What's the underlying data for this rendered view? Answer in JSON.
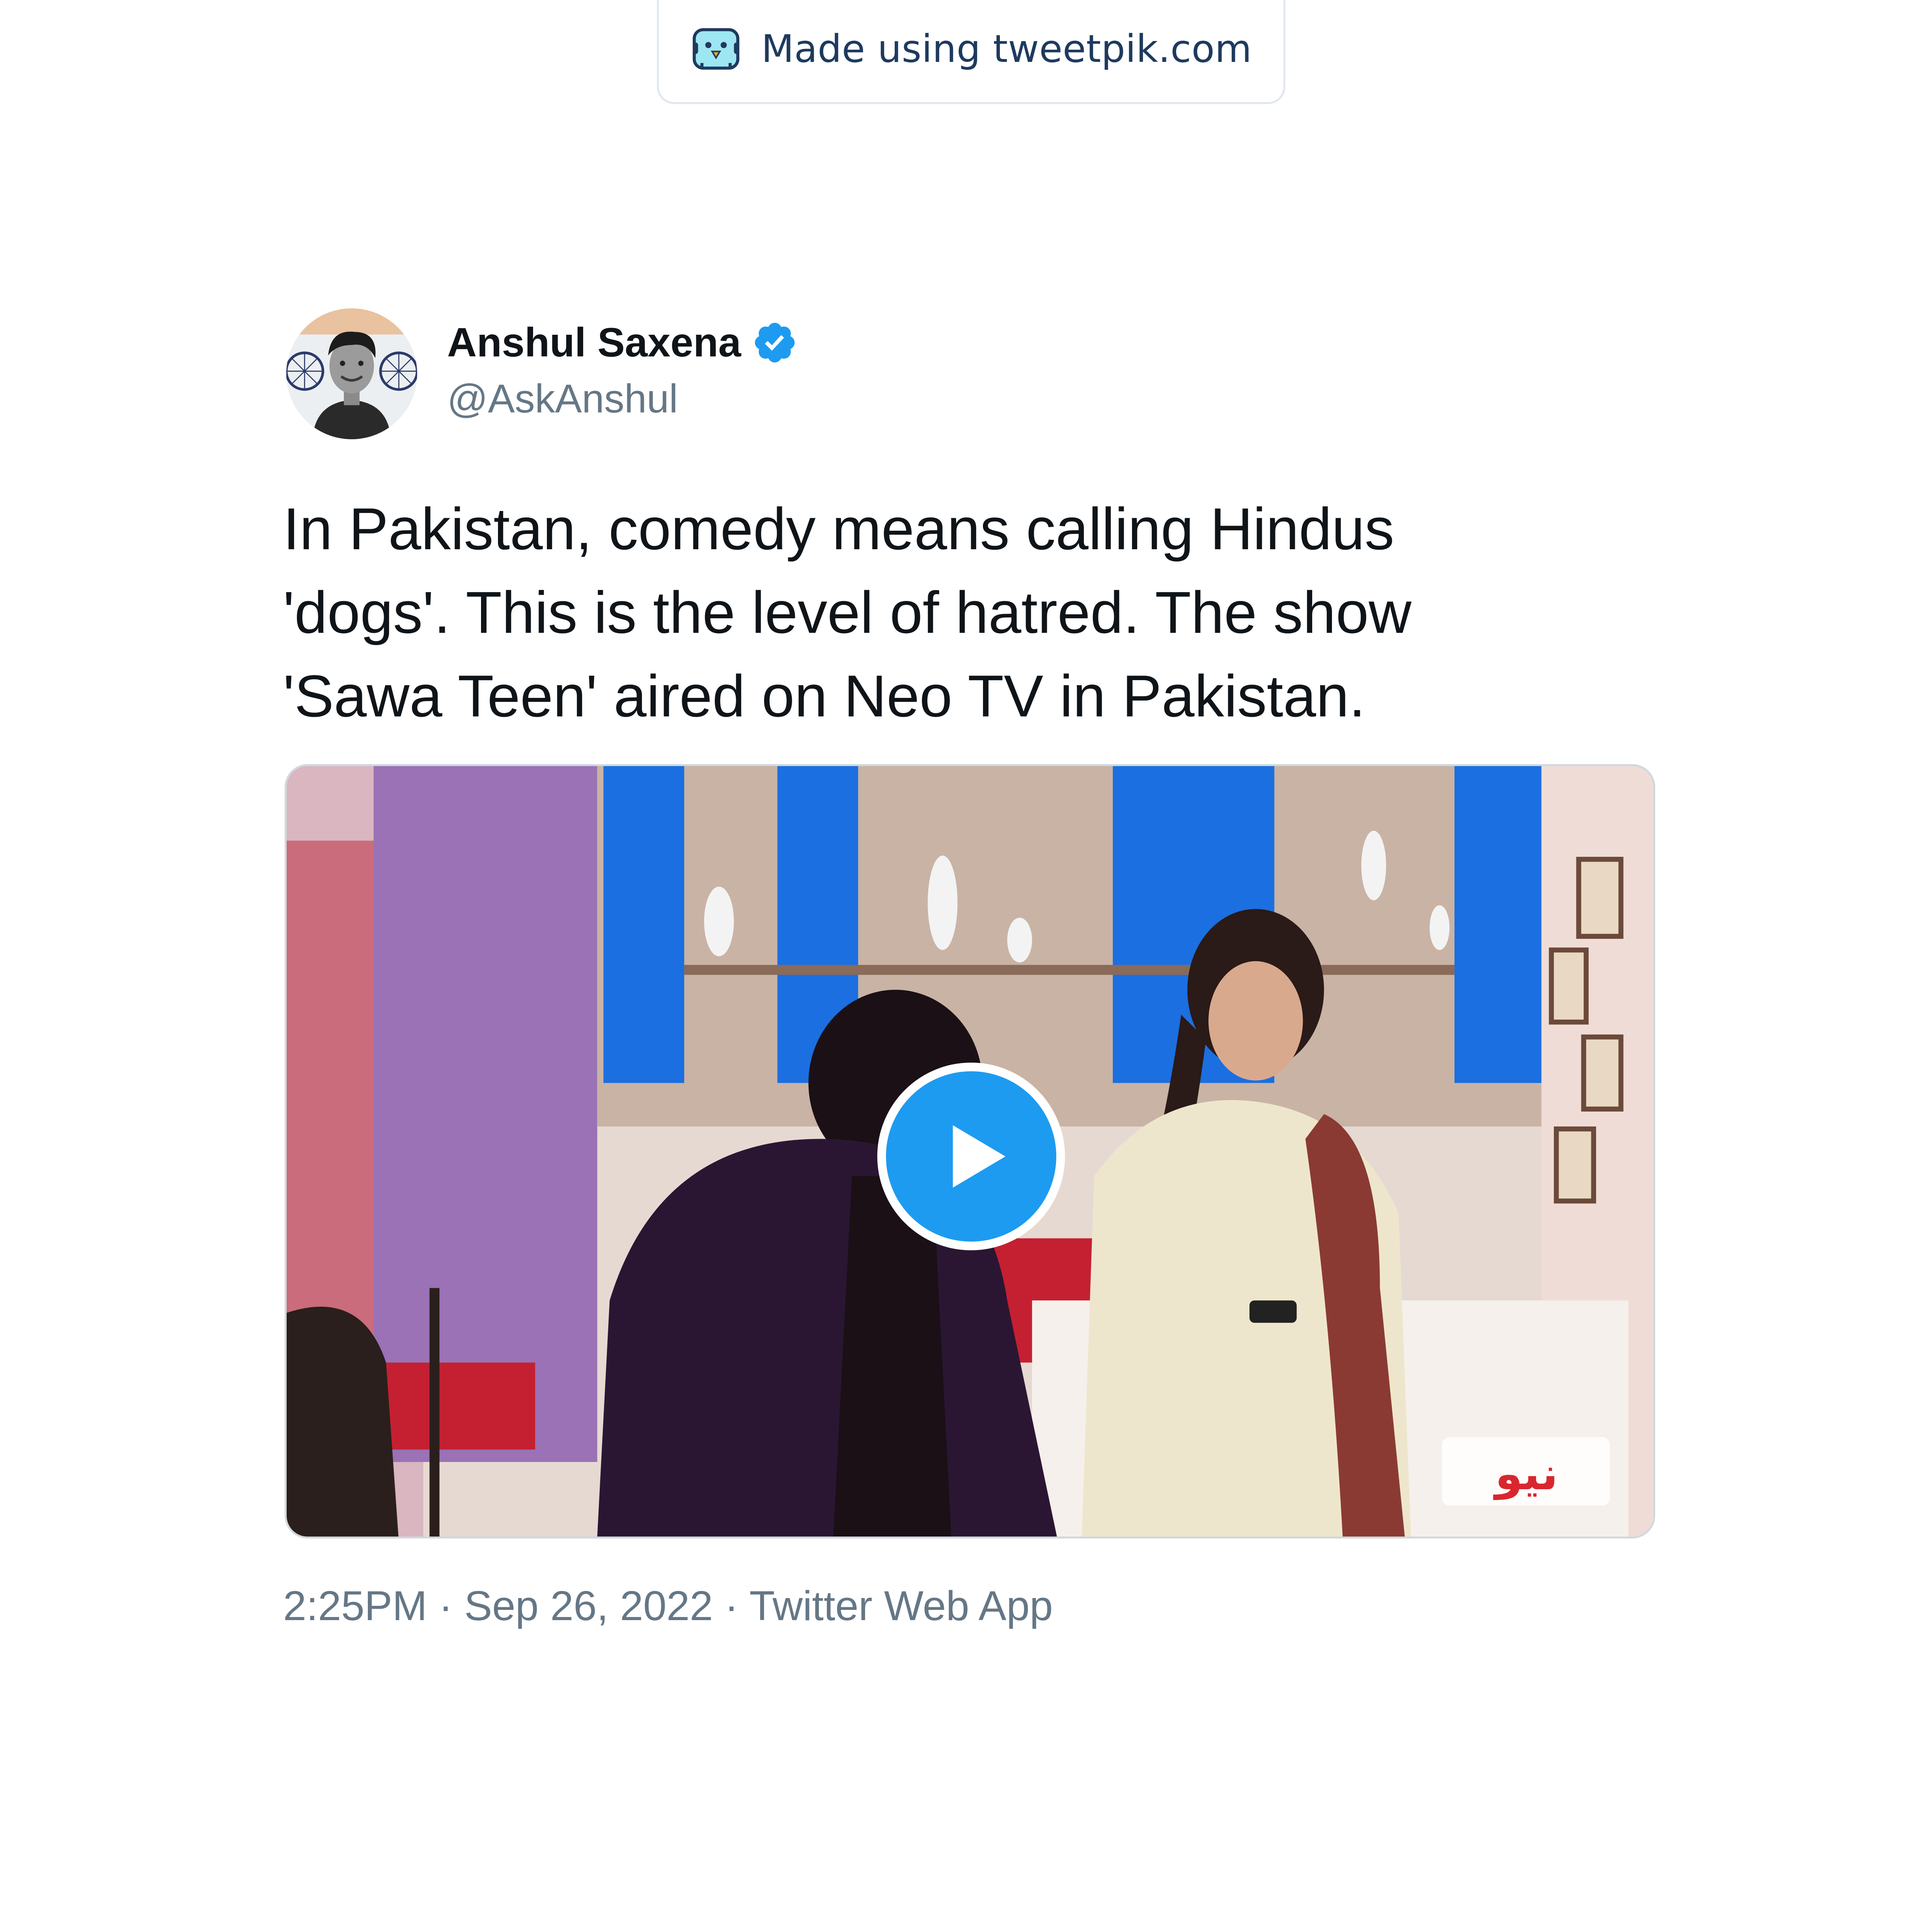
{
  "watermark": {
    "text": "Made using tweetpik.com",
    "icon": "tweetpik-bird-icon"
  },
  "author": {
    "display_name": "Anshul Saxena",
    "handle": "@AskAnshul",
    "verified": true,
    "verified_icon": "verified-badge-icon"
  },
  "tweet": {
    "text": "In Pakistan, comedy means calling Hindus\n'dogs'. This is the level of hatred. The show\n'Sawa Teen' aired on Neo TV in Pakistan."
  },
  "media": {
    "type": "video",
    "play_icon": "play-icon"
  },
  "meta": {
    "time": "2:25PM",
    "date": "Sep 26, 2022",
    "source": "Twitter Web App",
    "separator": "·"
  },
  "colors": {
    "text_primary": "#0f1419",
    "text_secondary": "#657786",
    "accent": "#1d9bf0",
    "watermark_text": "#1e3a5f"
  }
}
